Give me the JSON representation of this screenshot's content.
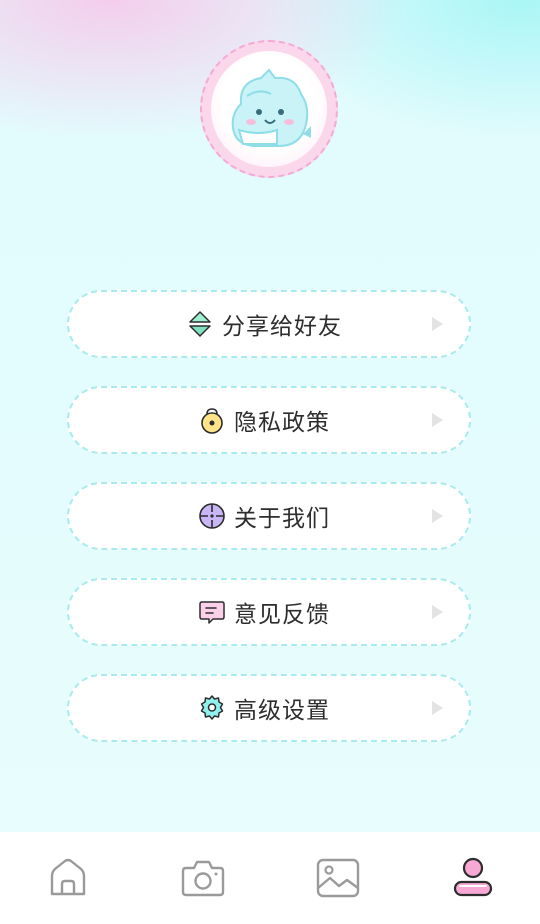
{
  "profile": {
    "avatar_icon": "mascot-character-icon"
  },
  "menu": [
    {
      "label": "分享给好友",
      "icon": "share-icon"
    },
    {
      "label": "隐私政策",
      "icon": "lock-icon"
    },
    {
      "label": "关于我们",
      "icon": "compass-icon"
    },
    {
      "label": "意见反馈",
      "icon": "message-icon"
    },
    {
      "label": "高级设置",
      "icon": "gear-icon"
    }
  ],
  "bottom_nav": [
    {
      "icon": "home-icon",
      "active": false
    },
    {
      "icon": "camera-icon",
      "active": false
    },
    {
      "icon": "gallery-icon",
      "active": false
    },
    {
      "icon": "profile-icon",
      "active": true
    }
  ],
  "colors": {
    "accent_cyan": "#a7ebee",
    "accent_pink": "#f3a9d4",
    "text": "#2d2d2d"
  }
}
